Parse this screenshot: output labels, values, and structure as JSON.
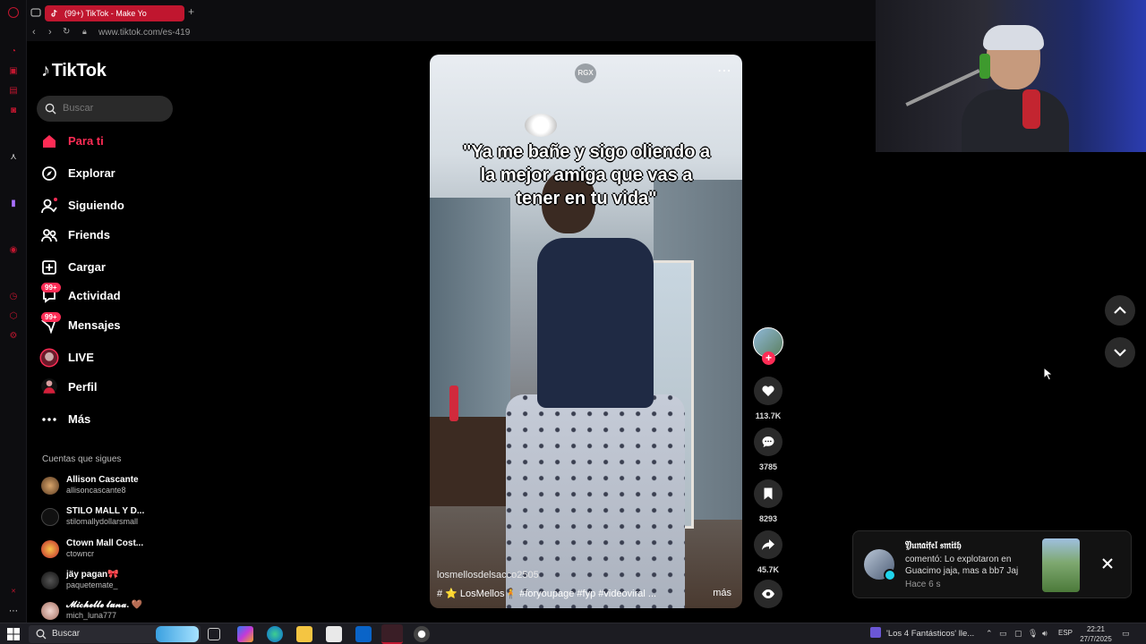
{
  "browser": {
    "tab_title": "(99+) TikTok - Make Yo",
    "new_tab": "+",
    "url": "www.tiktok.com/es-419"
  },
  "sidebar": {
    "logo": "TikTok",
    "search_placeholder": "Buscar",
    "nav": [
      {
        "label": "Para ti",
        "icon": "home-icon",
        "active": true
      },
      {
        "label": "Explorar",
        "icon": "compass-icon"
      },
      {
        "label": "Siguiendo",
        "icon": "following-icon"
      },
      {
        "label": "Friends",
        "icon": "friends-icon"
      },
      {
        "label": "Cargar",
        "icon": "upload-icon"
      },
      {
        "label": "Actividad",
        "icon": "activity-icon",
        "badge": "99+"
      },
      {
        "label": "Mensajes",
        "icon": "messages-icon",
        "badge": "99+"
      },
      {
        "label": "LIVE",
        "icon": "live-icon"
      },
      {
        "label": "Perfil",
        "icon": "profile-icon"
      },
      {
        "label": "Más",
        "icon": "more-icon"
      }
    ],
    "following_title": "Cuentas que sigues",
    "accounts": [
      {
        "name": "Allison Cascante",
        "handle": "allisoncascante8"
      },
      {
        "name": "STILO MALL Y D...",
        "handle": "stilomallydollarsmall"
      },
      {
        "name": "Ctown Mall Cost...",
        "handle": "ctowncr"
      },
      {
        "name": "jäy pagan🎀",
        "handle": "paquetemate_"
      },
      {
        "name": "𝓜𝓲𝓬𝓱𝓮𝓵𝓵𝓮 𝓵𝓾𝓷𝓪. 🤎",
        "handle": "mich_luna777"
      }
    ]
  },
  "video": {
    "watermark": "RGX",
    "caption": "\"Ya me bañe y sigo oliendo a la mejor amiga que vas a tener en tu vida\"",
    "username": "losmellosdelsacco2505",
    "tags": "# ⭐ LosMellos🧍 #foryoupage #fyp #videoviral ...",
    "more": "más"
  },
  "actions": {
    "follow": "+",
    "likes": "113.7K",
    "comments": "3785",
    "saves": "8293",
    "shares": "45.7K"
  },
  "notification": {
    "name": "𝔜𝔲𝔫𝔞𝔦𝔣𝔢𝔩 𝔰𝔪𝔦𝔱𝔥",
    "text": "comentó: Lo explotaron en Guacimo jaja, mas a bb7 Jaj",
    "time": "Hace 6 s"
  },
  "taskbar": {
    "search": "Buscar",
    "media": "'Los 4 Fantásticos' lle...",
    "lang": "ESP",
    "time": "22:21",
    "date": "27/7/2025"
  },
  "colors": {
    "accent": "#fe2c55",
    "opera_red": "#c0162f",
    "background": "#000000"
  }
}
